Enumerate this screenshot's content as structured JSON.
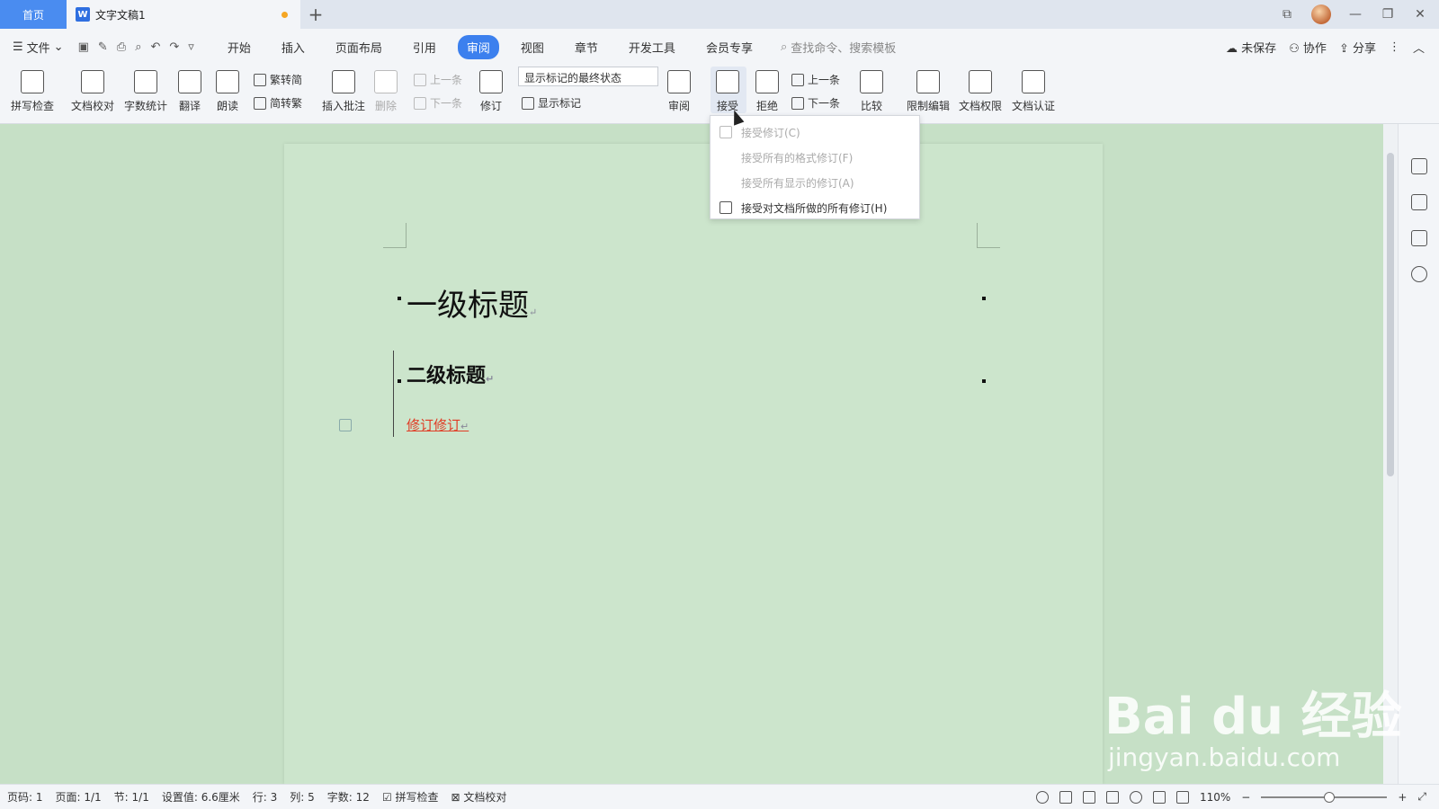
{
  "titlebar": {
    "home_tab": "首页",
    "doc_tab": "文字文稿1",
    "new_tab": "+",
    "win_controls": [
      "⧉",
      "—",
      "❐",
      "✕"
    ]
  },
  "menubar": {
    "file": "文件",
    "tabs": [
      "开始",
      "插入",
      "页面布局",
      "引用",
      "审阅",
      "视图",
      "章节",
      "开发工具",
      "会员专享"
    ],
    "active_tab": "审阅",
    "search": "查找命令、搜索模板",
    "unsaved": "未保存",
    "collab": "协作",
    "share": "分享"
  },
  "ribbon": {
    "spell": "拼写检查",
    "proof": "文档校对",
    "wordcount": "字数统计",
    "translate": "翻译",
    "read": "朗读",
    "trad_to_simp": "繁转简",
    "simp_to_trad": "简转繁",
    "insert_comment": "插入批注",
    "delete": "删除",
    "prev": "上一条",
    "next": "下一条",
    "revise": "修订",
    "markup_state": "显示标记的最终状态",
    "show_markup": "显示标记",
    "review": "审阅",
    "accept": "接受",
    "reject": "拒绝",
    "prev2": "上一条",
    "next2": "下一条",
    "compare": "比较",
    "restrict_edit": "限制编辑",
    "doc_permission": "文档权限",
    "doc_certify": "文档认证"
  },
  "dropdown": {
    "items": [
      {
        "label": "接受修订(C)",
        "disabled": true
      },
      {
        "label": "接受所有的格式修订(F)",
        "disabled": true
      },
      {
        "label": "接受所有显示的修订(A)",
        "disabled": true
      },
      {
        "label": "接受对文档所做的所有修订(H)",
        "disabled": false
      }
    ]
  },
  "document": {
    "heading1": "一级标题",
    "heading2": "二级标题",
    "revision_text": "修订修订",
    "para_mark": "↵"
  },
  "watermark": {
    "brand": "Bai du 经验",
    "url": "jingyan.baidu.com"
  },
  "statusbar": {
    "page_num": "页码: 1",
    "pages": "页面: 1/1",
    "section": "节: 1/1",
    "setting": "设置值: 6.6厘米",
    "row": "行: 3",
    "col": "列: 5",
    "wordcount": "字数: 12",
    "spell": "拼写检查",
    "proof": "文档校对",
    "zoom": "110%"
  }
}
